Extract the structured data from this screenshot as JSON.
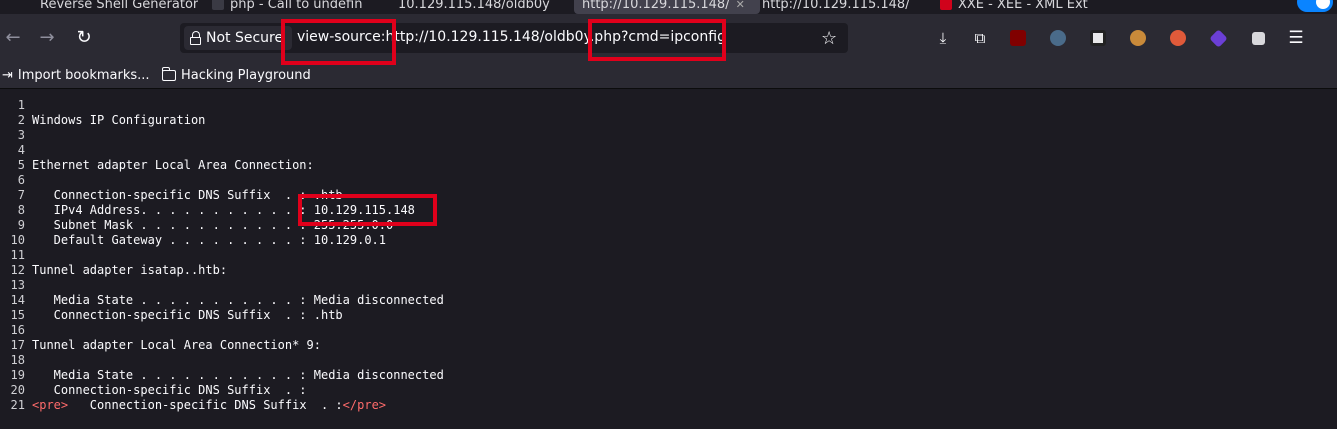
{
  "tabs": [
    {
      "label": "Reverse Shell Generator"
    },
    {
      "label": "php - Call to undefin"
    },
    {
      "label": "10.129.115.148/oldb0y"
    },
    {
      "label": "http://10.129.115.148/"
    },
    {
      "label": "http://10.129.115.148/"
    },
    {
      "label": "XXE - XEE - XML Ext"
    }
  ],
  "toolbar": {
    "back_icon": "back-arrow-icon",
    "forward_icon": "forward-arrow-icon",
    "reload_icon": "reload-icon",
    "site_info_label": "Not Secure",
    "url": "view-source:http://10.129.115.148/oldb0y.php?cmd=ipconfig",
    "bookmark_icon": "star-icon"
  },
  "bookmarks": [
    {
      "label": "Import bookmarks...",
      "icon": "import-icon"
    },
    {
      "label": "Hacking Playground",
      "icon": "folder-icon"
    }
  ],
  "source_lines": [
    {
      "n": "1",
      "text": ""
    },
    {
      "n": "2",
      "text": "Windows IP Configuration"
    },
    {
      "n": "3",
      "text": ""
    },
    {
      "n": "4",
      "text": ""
    },
    {
      "n": "5",
      "text": "Ethernet adapter Local Area Connection:"
    },
    {
      "n": "6",
      "text": ""
    },
    {
      "n": "7",
      "text": "   Connection-specific DNS Suffix  . : .htb"
    },
    {
      "n": "8",
      "text": "   IPv4 Address. . . . . . . . . . . : 10.129.115.148"
    },
    {
      "n": "9",
      "text": "   Subnet Mask . . . . . . . . . . . : 255.255.0.0"
    },
    {
      "n": "10",
      "text": "   Default Gateway . . . . . . . . . : 10.129.0.1"
    },
    {
      "n": "11",
      "text": ""
    },
    {
      "n": "12",
      "text": "Tunnel adapter isatap..htb:"
    },
    {
      "n": "13",
      "text": ""
    },
    {
      "n": "14",
      "text": "   Media State . . . . . . . . . . . : Media disconnected"
    },
    {
      "n": "15",
      "text": "   Connection-specific DNS Suffix  . : .htb"
    },
    {
      "n": "16",
      "text": ""
    },
    {
      "n": "17",
      "text": "Tunnel adapter Local Area Connection* 9:"
    },
    {
      "n": "18",
      "text": ""
    },
    {
      "n": "19",
      "text": "   Media State . . . . . . . . . . . : Media disconnected"
    },
    {
      "n": "20",
      "text": "   Connection-specific DNS Suffix  . :"
    }
  ],
  "last_line": {
    "n": "21",
    "open_tag": "<pre>",
    "text": "   Connection-specific DNS Suffix  . :",
    "close_tag": "</pre>"
  },
  "colors": {
    "highlight": "#e0001b",
    "tag": "#ff6b6b",
    "background": "#1c1b22",
    "toolbar": "#2b2a33"
  }
}
